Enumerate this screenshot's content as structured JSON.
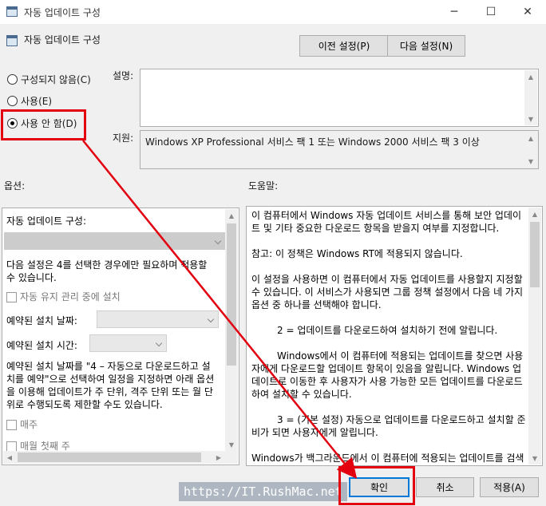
{
  "window": {
    "title": "자동 업데이트 구성",
    "minimize": "─",
    "maximize": "☐",
    "close": "✕"
  },
  "header": {
    "title": "자동 업데이트 구성",
    "prev_setting": "이전 설정(P)",
    "next_setting": "다음 설정(N)"
  },
  "state": {
    "not_configured": "구성되지 않음(C)",
    "enabled": "사용(E)",
    "disabled": "사용 안 함(D)",
    "selected": "disabled"
  },
  "comment": {
    "label": "설명:",
    "value": ""
  },
  "supported": {
    "label": "지원:",
    "value": "Windows XP Professional 서비스 팩 1 또는 Windows 2000 서비스 팩 3 이상"
  },
  "options": {
    "label": "옵션:",
    "configure_label": "자동 업데이트 구성:",
    "line1": "다음 설정은 4를 선택한 경우에만 필요하며 적용할",
    "line2": "수 있습니다.",
    "maintenance_install": "자동 유지 관리 중에 설치",
    "scheduled_day": "예약된 설치 날짜:",
    "scheduled_time": "예약된 설치 시간:",
    "desc1": "예약된 설치 날짜를 \"4 – 자동으로 다운로드하고 설",
    "desc2": "치를 예약\"으로 선택하여 일정을 지정하면 아래 옵션",
    "desc3": "을 이용해 업데이트가 주 단위, 격주 단위 또는 월 단",
    "desc4": "위로 수행되도록 제한할 수도 있습니다.",
    "every_week": "매주",
    "first_week": "매월 첫째 주"
  },
  "help": {
    "label": "도움말:",
    "paragraphs": [
      "이 컴퓨터에서 Windows 자동 업데이트 서비스를 통해 보안 업데이트 및 기타 중요한 다운로드 항목을 받을지 여부를 지정합니다.",
      "참고: 이 정책은 Windows RT에 적용되지 않습니다.",
      "이 설정을 사용하면 이 컴퓨터에서 자동 업데이트를 사용할지 지정할 수 있습니다. 이 서비스가 사용되면 그룹 정책 설정에서 다음 네 가지 옵션 중 하나를 선택해야 합니다.",
      "2 = 업데이트를 다운로드하여 설치하기 전에 알립니다.",
      "Windows에서 이 컴퓨터에 적용되는 업데이트를 찾으면 사용자에게 다운로드할 업데이트 항목이 있음을 알립니다. Windows 업데이트로 이동한 후 사용자가 사용 가능한 모든 업데이트를 다운로드하여 설치할 수 있습니다.",
      "3 = (기본 설정) 자동으로 업데이트를 다운로드하고 설치할 준비가 되면 사용자에게 알립니다.",
      "Windows가 백그라운드에서 이 컴퓨터에 적용되는 업데이트를 검색하고 다운로드합니다. 이 작업은 지장되는 동안에는 인지하"
    ]
  },
  "buttons": {
    "ok": "확인",
    "cancel": "취소",
    "apply": "적용(A)"
  },
  "watermark": "https://IT.RushMac.net",
  "colors": {
    "annotation": "#e3000f",
    "accent": "#0078d7"
  }
}
